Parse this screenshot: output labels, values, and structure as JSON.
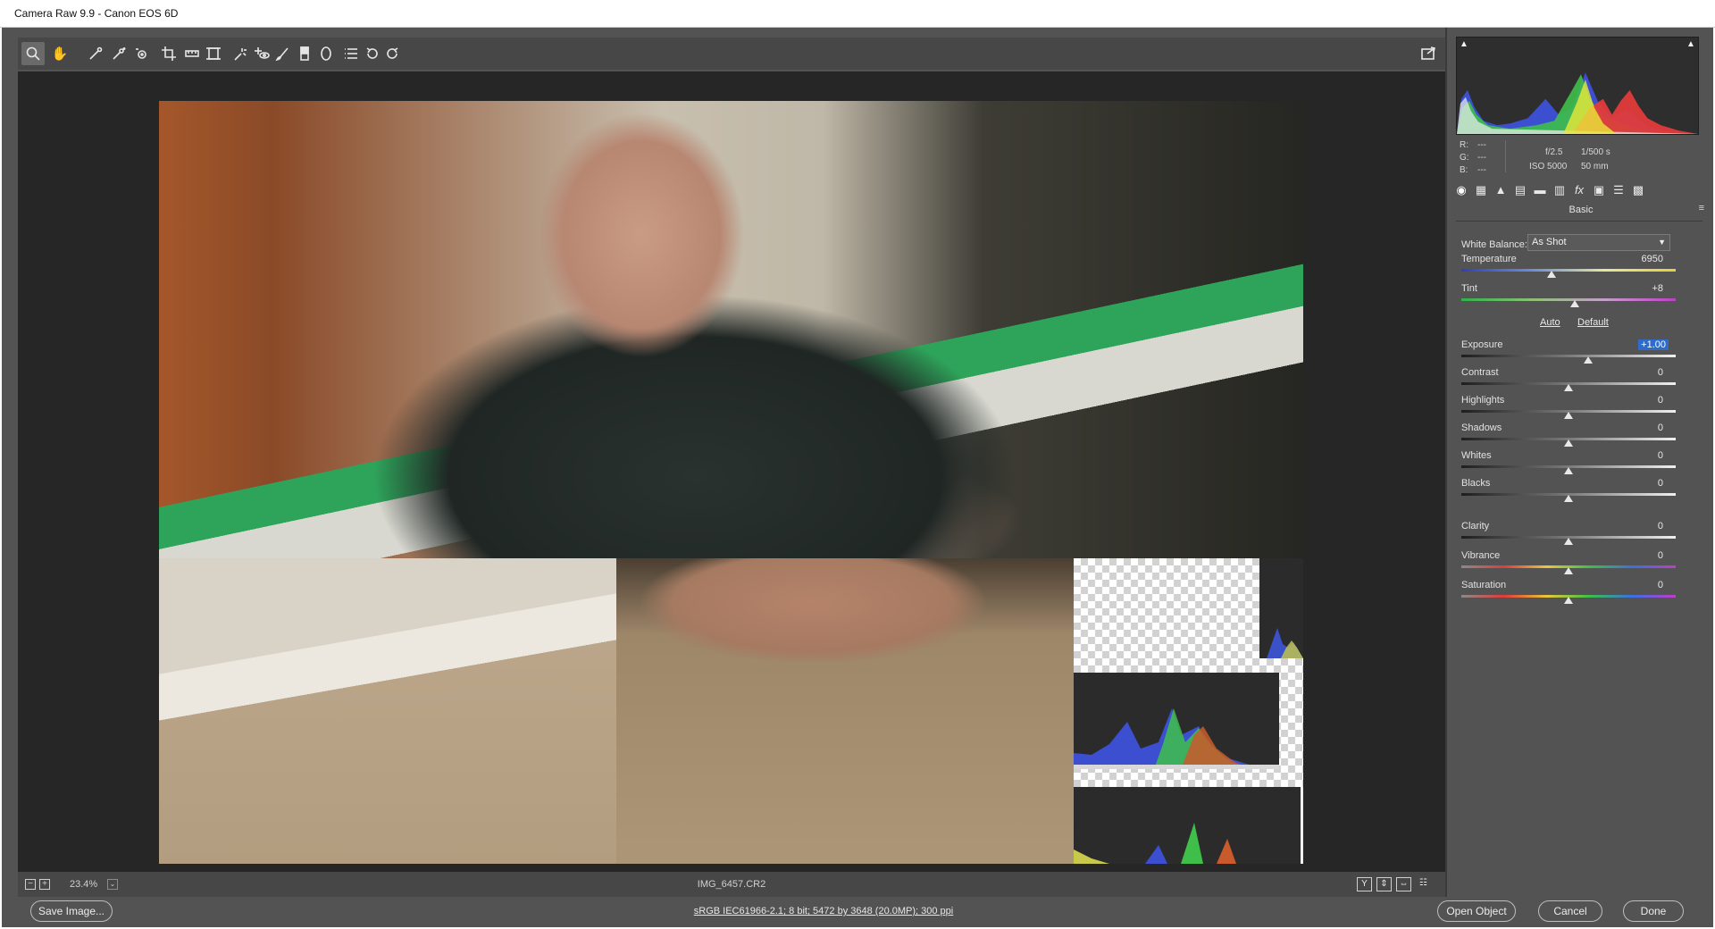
{
  "window": {
    "title": "Camera Raw 9.9  -  Canon EOS 6D"
  },
  "toolbar": {
    "tools": [
      {
        "name": "zoom-tool-icon",
        "glyph": "🔍"
      },
      {
        "name": "hand-tool-icon",
        "glyph": "✋"
      },
      {
        "name": "white-balance-tool-icon",
        "glyph": "⟋"
      },
      {
        "name": "color-sampler-tool-icon",
        "glyph": "✱"
      },
      {
        "name": "targeted-adjustment-tool-icon",
        "glyph": "◎"
      },
      {
        "name": "crop-tool-icon",
        "glyph": "⌗"
      },
      {
        "name": "straighten-tool-icon",
        "glyph": "▭"
      },
      {
        "name": "transform-tool-icon",
        "glyph": "⊞"
      },
      {
        "name": "spot-removal-tool-icon",
        "glyph": "⟡"
      },
      {
        "name": "red-eye-removal-tool-icon",
        "glyph": "⊹"
      },
      {
        "name": "adjustment-brush-icon",
        "glyph": "✎"
      },
      {
        "name": "graduated-filter-icon",
        "glyph": "▮"
      },
      {
        "name": "radial-filter-icon",
        "glyph": "◯"
      },
      {
        "name": "preferences-icon",
        "glyph": "☰"
      },
      {
        "name": "rotate-left-icon",
        "glyph": "↺"
      },
      {
        "name": "rotate-right-icon",
        "glyph": "↻"
      }
    ],
    "fullscreen_icon": "⇱"
  },
  "statusbar": {
    "zoom_out": "−",
    "zoom_in": "+",
    "zoom_level": "23.4%",
    "zoom_dropdown": "⌄",
    "filename": "IMG_6457.CR2",
    "view_buttons": [
      "Y",
      "⇕",
      "⇔",
      "☷"
    ]
  },
  "bottombar": {
    "save_label": "Save Image...",
    "workflow": "sRGB IEC61966-2.1; 8 bit; 5472 by 3648 (20.0MP); 300 ppi",
    "open_label": "Open Object",
    "cancel_label": "Cancel",
    "done_label": "Done"
  },
  "info": {
    "r_label": "R:",
    "r_val": "---",
    "g_label": "G:",
    "g_val": "---",
    "b_label": "B:",
    "b_val": "---",
    "aperture": "f/2.5",
    "shutter": "1/500 s",
    "iso": "ISO 5000",
    "focal": "50 mm"
  },
  "tabs": [
    {
      "name": "basic-tab-icon",
      "glyph": "◉"
    },
    {
      "name": "tone-curve-tab-icon",
      "glyph": "▦"
    },
    {
      "name": "detail-tab-icon",
      "glyph": "▲"
    },
    {
      "name": "hsl-tab-icon",
      "glyph": "▤"
    },
    {
      "name": "split-toning-tab-icon",
      "glyph": "▬"
    },
    {
      "name": "lens-corrections-tab-icon",
      "glyph": "▥"
    },
    {
      "name": "effects-tab-icon",
      "glyph": "fx"
    },
    {
      "name": "camera-calibration-tab-icon",
      "glyph": "▣"
    },
    {
      "name": "presets-tab-icon",
      "glyph": "☰"
    },
    {
      "name": "snapshots-tab-icon",
      "glyph": "▩"
    }
  ],
  "panel": {
    "title": "Basic",
    "menu_glyph": "≡",
    "white_balance_label": "White Balance:",
    "white_balance_value": "As Shot",
    "auto_label": "Auto",
    "default_label": "Default",
    "sliders": [
      {
        "label": "Temperature",
        "value": "6950",
        "position": 0.42
      },
      {
        "label": "Tint",
        "value": "+8",
        "position": 0.53
      },
      {
        "label": "Exposure",
        "value": "+1.00",
        "position": 0.59
      },
      {
        "label": "Contrast",
        "value": "0",
        "position": 0.5
      },
      {
        "label": "Highlights",
        "value": "0",
        "position": 0.5
      },
      {
        "label": "Shadows",
        "value": "0",
        "position": 0.5
      },
      {
        "label": "Whites",
        "value": "0",
        "position": 0.5
      },
      {
        "label": "Blacks",
        "value": "0",
        "position": 0.5
      },
      {
        "label": "Clarity",
        "value": "0",
        "position": 0.5
      },
      {
        "label": "Vibrance",
        "value": "0",
        "position": 0.5
      },
      {
        "label": "Saturation",
        "value": "0",
        "position": 0.5
      }
    ]
  },
  "colors": {
    "panel_bg": "#535353",
    "canvas_bg": "#262626",
    "highlight": "#2d6ccc"
  }
}
